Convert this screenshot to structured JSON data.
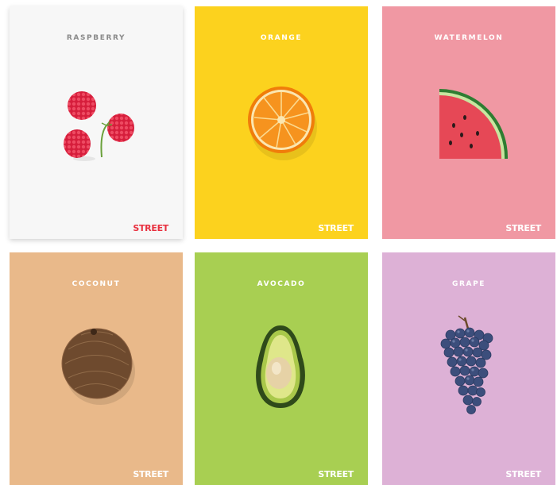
{
  "brand": "STREET",
  "cards": [
    {
      "title": "RASPBERRY",
      "fruit_icon": "raspberry-icon",
      "background": "#f7f7f7",
      "title_color": "#8a8a8a",
      "brand_color": "#e8303f"
    },
    {
      "title": "ORANGE",
      "fruit_icon": "orange-slice-icon",
      "background": "#fcd21e",
      "title_color": "#ffffff",
      "brand_color": "#ffffff"
    },
    {
      "title": "WATERMELON",
      "fruit_icon": "watermelon-slice-icon",
      "background": "#f098a3",
      "title_color": "#ffffff",
      "brand_color": "#ffffff"
    },
    {
      "title": "COCONUT",
      "fruit_icon": "coconut-icon",
      "background": "#e9b98a",
      "title_color": "#ffffff",
      "brand_color": "#ffffff"
    },
    {
      "title": "AVOCADO",
      "fruit_icon": "avocado-half-icon",
      "background": "#a8cf52",
      "title_color": "#ffffff",
      "brand_color": "#ffffff"
    },
    {
      "title": "GRAPE",
      "fruit_icon": "grape-bunch-icon",
      "background": "#ddb1d6",
      "title_color": "#ffffff",
      "brand_color": "#ffffff"
    }
  ]
}
